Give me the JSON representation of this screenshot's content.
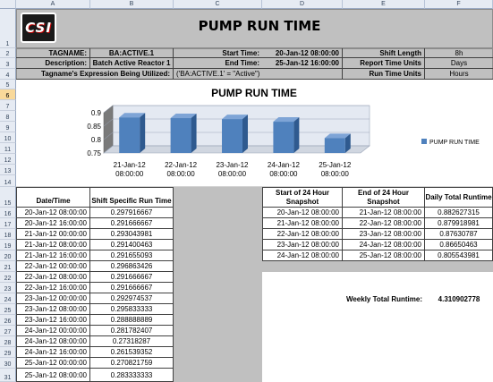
{
  "columns": [
    "A",
    "B",
    "C",
    "D",
    "E",
    "F"
  ],
  "rows": [
    "1",
    "2",
    "3",
    "4",
    "5",
    "6",
    "7",
    "8",
    "9",
    "10",
    "11",
    "12",
    "13",
    "14",
    "15",
    "16",
    "17",
    "18",
    "19",
    "20",
    "21",
    "22",
    "23",
    "24",
    "25",
    "26",
    "27",
    "28",
    "29",
    "30",
    "31"
  ],
  "logo_text": "CSI",
  "title": "PUMP RUN TIME",
  "info": {
    "tagname_label": "TAGNAME:",
    "tagname_value": "BA:ACTIVE.1",
    "start_label": "Start Time:",
    "start_value": "20-Jan-12 08:00:00",
    "shift_label": "Shift Length",
    "shift_value": "8h",
    "desc_label": "Description:",
    "desc_value": "Batch Active Reactor 1",
    "end_label": "End Time:",
    "end_value": "25-Jan-12 16:00:00",
    "report_units_label": "Report Time Units",
    "report_units_value": "Days",
    "expr_label": "Tagname's Expression Being Utilized:",
    "expr_value": "('BA:ACTIVE.1' = \"Active\")",
    "run_units_label": "Run Time Units",
    "run_units_value": "Hours"
  },
  "chart_data": {
    "type": "bar",
    "title": "PUMP RUN TIME",
    "categories": [
      "21-Jan-12 08:00:00",
      "22-Jan-12 08:00:00",
      "23-Jan-12 08:00:00",
      "24-Jan-12 08:00:00",
      "25-Jan-12 08:00:00"
    ],
    "series": [
      {
        "name": "PUMP RUN TIME",
        "values": [
          0.882627315,
          0.879918981,
          0.87630787,
          0.86650463,
          0.805543981
        ]
      }
    ],
    "ylim": [
      0.75,
      0.9
    ],
    "yticks": [
      "0.9",
      "0.85",
      "0.8",
      "0.75"
    ],
    "legend": "right",
    "color": "#4f81bd"
  },
  "left_table": {
    "headers": [
      "Date/Time",
      "Shift Specific Run Time"
    ],
    "rows": [
      [
        "20-Jan-12 08:00:00",
        "0.297916667"
      ],
      [
        "20-Jan-12 16:00:00",
        "0.291666667"
      ],
      [
        "21-Jan-12 00:00:00",
        "0.293043981"
      ],
      [
        "21-Jan-12 08:00:00",
        "0.291400463"
      ],
      [
        "21-Jan-12 16:00:00",
        "0.291655093"
      ],
      [
        "22-Jan-12 00:00:00",
        "0.296863426"
      ],
      [
        "22-Jan-12 08:00:00",
        "0.291666667"
      ],
      [
        "22-Jan-12 16:00:00",
        "0.291666667"
      ],
      [
        "23-Jan-12 00:00:00",
        "0.292974537"
      ],
      [
        "23-Jan-12 08:00:00",
        "0.295833333"
      ],
      [
        "23-Jan-12 16:00:00",
        "0.288888889"
      ],
      [
        "24-Jan-12 00:00:00",
        "0.281782407"
      ],
      [
        "24-Jan-12 08:00:00",
        "0.27318287"
      ],
      [
        "24-Jan-12 16:00:00",
        "0.261539352"
      ],
      [
        "25-Jan-12 00:00:00",
        "0.270821759"
      ],
      [
        "25-Jan-12 08:00:00",
        "0.283333333"
      ]
    ]
  },
  "right_table": {
    "headers": [
      "Start of 24 Hour Snapshot",
      "End of 24 Hour Snapshot",
      "Daily Total Runtime"
    ],
    "rows": [
      [
        "20-Jan-12 08:00:00",
        "21-Jan-12 08:00:00",
        "0.882627315"
      ],
      [
        "21-Jan-12 08:00:00",
        "22-Jan-12 08:00:00",
        "0.879918981"
      ],
      [
        "22-Jan-12 08:00:00",
        "23-Jan-12 08:00:00",
        "0.87630787"
      ],
      [
        "23-Jan-12 08:00:00",
        "24-Jan-12 08:00:00",
        "0.86650463"
      ],
      [
        "24-Jan-12 08:00:00",
        "25-Jan-12 08:00:00",
        "0.805543981"
      ]
    ]
  },
  "weekly": {
    "label": "Weekly Total Runtime:",
    "value": "4.310902778"
  }
}
